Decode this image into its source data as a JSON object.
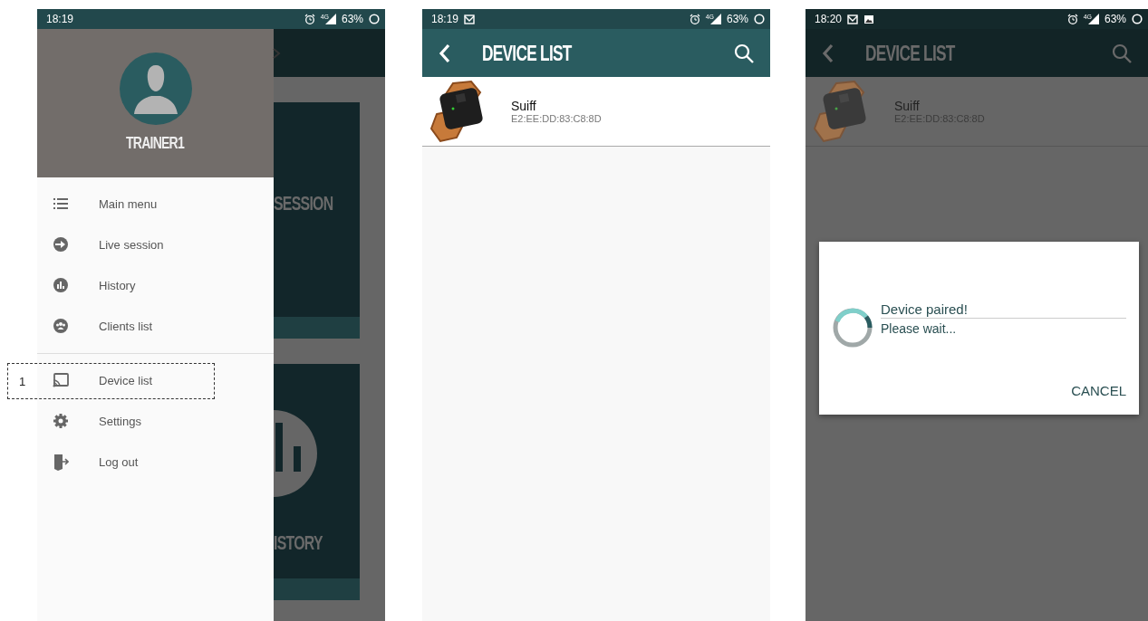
{
  "screens": [
    {
      "kind": "drawer",
      "status_bar": {
        "time": "18:19",
        "network": "4G",
        "battery": "63%"
      },
      "drawer": {
        "user": "TRAINER1",
        "sections": [
          [
            {
              "label": "Main menu"
            },
            {
              "label": "Live session"
            },
            {
              "label": "History"
            },
            {
              "label": "Clients list"
            }
          ],
          [
            {
              "label": "Device list",
              "callout": "1"
            },
            {
              "label": "Settings"
            },
            {
              "label": "Log out"
            }
          ]
        ]
      },
      "background": {
        "cards": [
          {
            "kind": "session",
            "label": "SESSION"
          },
          {
            "kind": "history",
            "label": "ISTORY"
          }
        ]
      }
    },
    {
      "kind": "list",
      "status_bar": {
        "time": "18:19",
        "notification_icons": [
          {
            "kind": "mail"
          }
        ],
        "network": "4G",
        "battery": "63%"
      },
      "app_bar": {
        "title": "DEVICE LIST"
      },
      "devices": [
        {
          "name": "Suiff",
          "address": "E2:EE:DD:83:C8:8D"
        }
      ]
    },
    {
      "kind": "list",
      "status_bar": {
        "time": "18:20",
        "notification_icons": [
          {
            "kind": "mail"
          },
          {
            "kind": "image"
          }
        ],
        "network": "4G",
        "battery": "63%"
      },
      "app_bar": {
        "title": "DEVICE LIST"
      },
      "devices": [
        {
          "name": "Suiff",
          "address": "E2:EE:DD:83:C8:8D"
        }
      ],
      "dialog": {
        "title": "Device paired!",
        "message": "Please wait...",
        "button": "CANCEL"
      }
    }
  ]
}
